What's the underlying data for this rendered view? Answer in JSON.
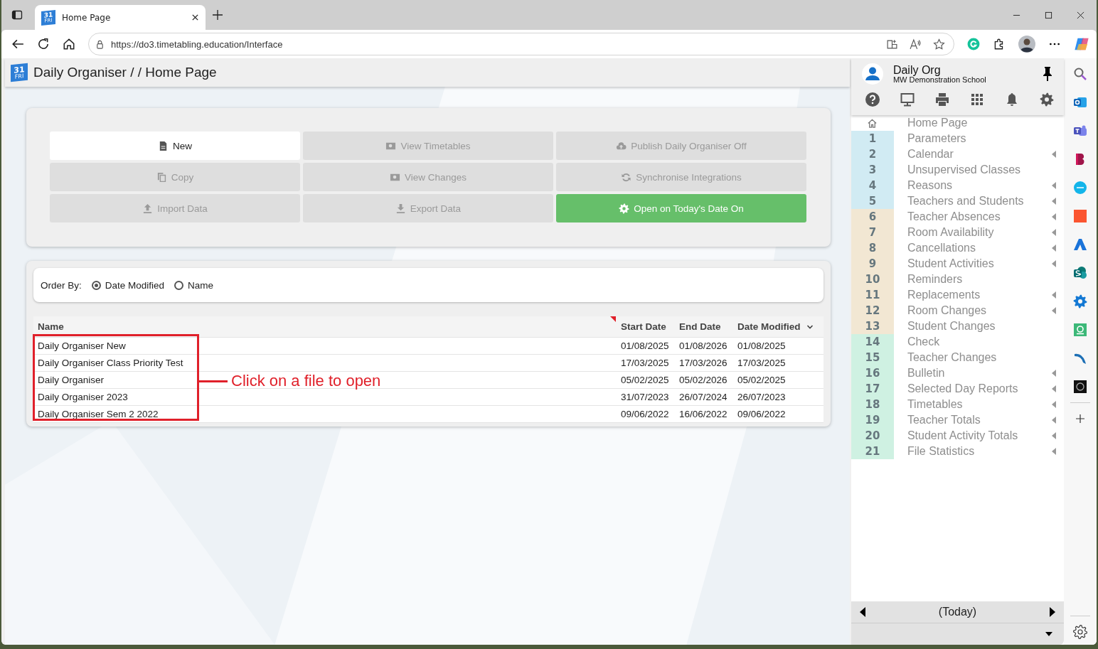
{
  "browser": {
    "tab": {
      "title": "Home Page",
      "logo_day": "31",
      "logo_weekday": "FRI"
    },
    "address": "https://do3.timetabling.education/Interface"
  },
  "header": {
    "logo_day": "31",
    "logo_weekday": "FRI",
    "title": "Daily Organiser / / Home Page"
  },
  "actions": [
    {
      "label": "New",
      "kind": "primary"
    },
    {
      "label": "View Timetables",
      "kind": "disabled"
    },
    {
      "label": "Publish Daily Organiser Off",
      "kind": "disabled"
    },
    {
      "label": "Copy",
      "kind": "disabled"
    },
    {
      "label": "View Changes",
      "kind": "disabled"
    },
    {
      "label": "Synchronise Integrations",
      "kind": "disabled"
    },
    {
      "label": "Import Data",
      "kind": "disabled"
    },
    {
      "label": "Export Data",
      "kind": "disabled"
    },
    {
      "label": "Open on Today's Date On",
      "kind": "toggle_on"
    }
  ],
  "order_by": {
    "label": "Order By:",
    "options": [
      {
        "label": "Date Modified",
        "selected": true
      },
      {
        "label": "Name",
        "selected": false
      }
    ]
  },
  "table": {
    "columns": [
      {
        "label": "Name",
        "sorted": false
      },
      {
        "label": "Start Date",
        "sorted": false
      },
      {
        "label": "End Date",
        "sorted": false
      },
      {
        "label": "Date Modified",
        "sorted": true
      }
    ],
    "rows": [
      {
        "name": "Daily Organiser New",
        "start": "01/08/2025",
        "end": "01/08/2026",
        "modified": "01/08/2025"
      },
      {
        "name": "Daily Organiser Class Priority Test",
        "start": "17/03/2025",
        "end": "17/03/2026",
        "modified": "17/03/2025"
      },
      {
        "name": "Daily Organiser",
        "start": "05/02/2025",
        "end": "05/02/2026",
        "modified": "05/02/2025"
      },
      {
        "name": "Daily Organiser 2023",
        "start": "31/07/2023",
        "end": "26/07/2024",
        "modified": "26/07/2023"
      },
      {
        "name": "Daily Organiser Sem 2 2022",
        "start": "09/06/2022",
        "end": "16/06/2022",
        "modified": "09/06/2022"
      }
    ]
  },
  "callout": "Click on a file to open",
  "panel": {
    "title": "Daily Org",
    "subtitle": "MW Demonstration School",
    "nav": [
      {
        "kind": "home",
        "label": "Home Page",
        "submenu": false
      },
      {
        "kind": "step",
        "number": "1",
        "label": "Parameters",
        "color": "#d1ebf3",
        "submenu": false
      },
      {
        "kind": "step",
        "number": "2",
        "label": "Calendar",
        "color": "#d1ebf3",
        "submenu": true
      },
      {
        "kind": "step",
        "number": "3",
        "label": "Unsupervised Classes",
        "color": "#d1ebf3",
        "submenu": false
      },
      {
        "kind": "step",
        "number": "4",
        "label": "Reasons",
        "color": "#d1ebf3",
        "submenu": true
      },
      {
        "kind": "step",
        "number": "5",
        "label": "Teachers and Students",
        "color": "#d1ebf3",
        "submenu": true
      },
      {
        "kind": "step",
        "number": "6",
        "label": "Teacher Absences",
        "color": "#f2e7d3",
        "submenu": true
      },
      {
        "kind": "step",
        "number": "7",
        "label": "Room Availability",
        "color": "#f2e7d3",
        "submenu": true
      },
      {
        "kind": "step",
        "number": "8",
        "label": "Cancellations",
        "color": "#f2e7d3",
        "submenu": true
      },
      {
        "kind": "step",
        "number": "9",
        "label": "Student Activities",
        "color": "#f2e7d3",
        "submenu": true
      },
      {
        "kind": "step",
        "number": "10",
        "label": "Reminders",
        "color": "#f2e7d3",
        "submenu": false
      },
      {
        "kind": "step",
        "number": "11",
        "label": "Replacements",
        "color": "#f2e7d3",
        "submenu": true
      },
      {
        "kind": "step",
        "number": "12",
        "label": "Room Changes",
        "color": "#f2e7d3",
        "submenu": true
      },
      {
        "kind": "step",
        "number": "13",
        "label": "Student Changes",
        "color": "#f2e7d3",
        "submenu": false
      },
      {
        "kind": "step",
        "number": "14",
        "label": "Check",
        "color": "#cff1e2",
        "submenu": false
      },
      {
        "kind": "step",
        "number": "15",
        "label": "Teacher Changes",
        "color": "#cff1e2",
        "submenu": false
      },
      {
        "kind": "step",
        "number": "16",
        "label": "Bulletin",
        "color": "#cff1e2",
        "submenu": true
      },
      {
        "kind": "step",
        "number": "17",
        "label": "Selected Day Reports",
        "color": "#cff1e2",
        "submenu": true
      },
      {
        "kind": "step",
        "number": "18",
        "label": "Timetables",
        "color": "#cff1e2",
        "submenu": true
      },
      {
        "kind": "step",
        "number": "19",
        "label": "Teacher Totals",
        "color": "#cff1e2",
        "submenu": true
      },
      {
        "kind": "step",
        "number": "20",
        "label": "Student Activity Totals",
        "color": "#cff1e2",
        "submenu": true
      },
      {
        "kind": "step",
        "number": "21",
        "label": "File Statistics",
        "color": "#cff1e2",
        "submenu": true
      }
    ],
    "date_label": "(Today)"
  }
}
